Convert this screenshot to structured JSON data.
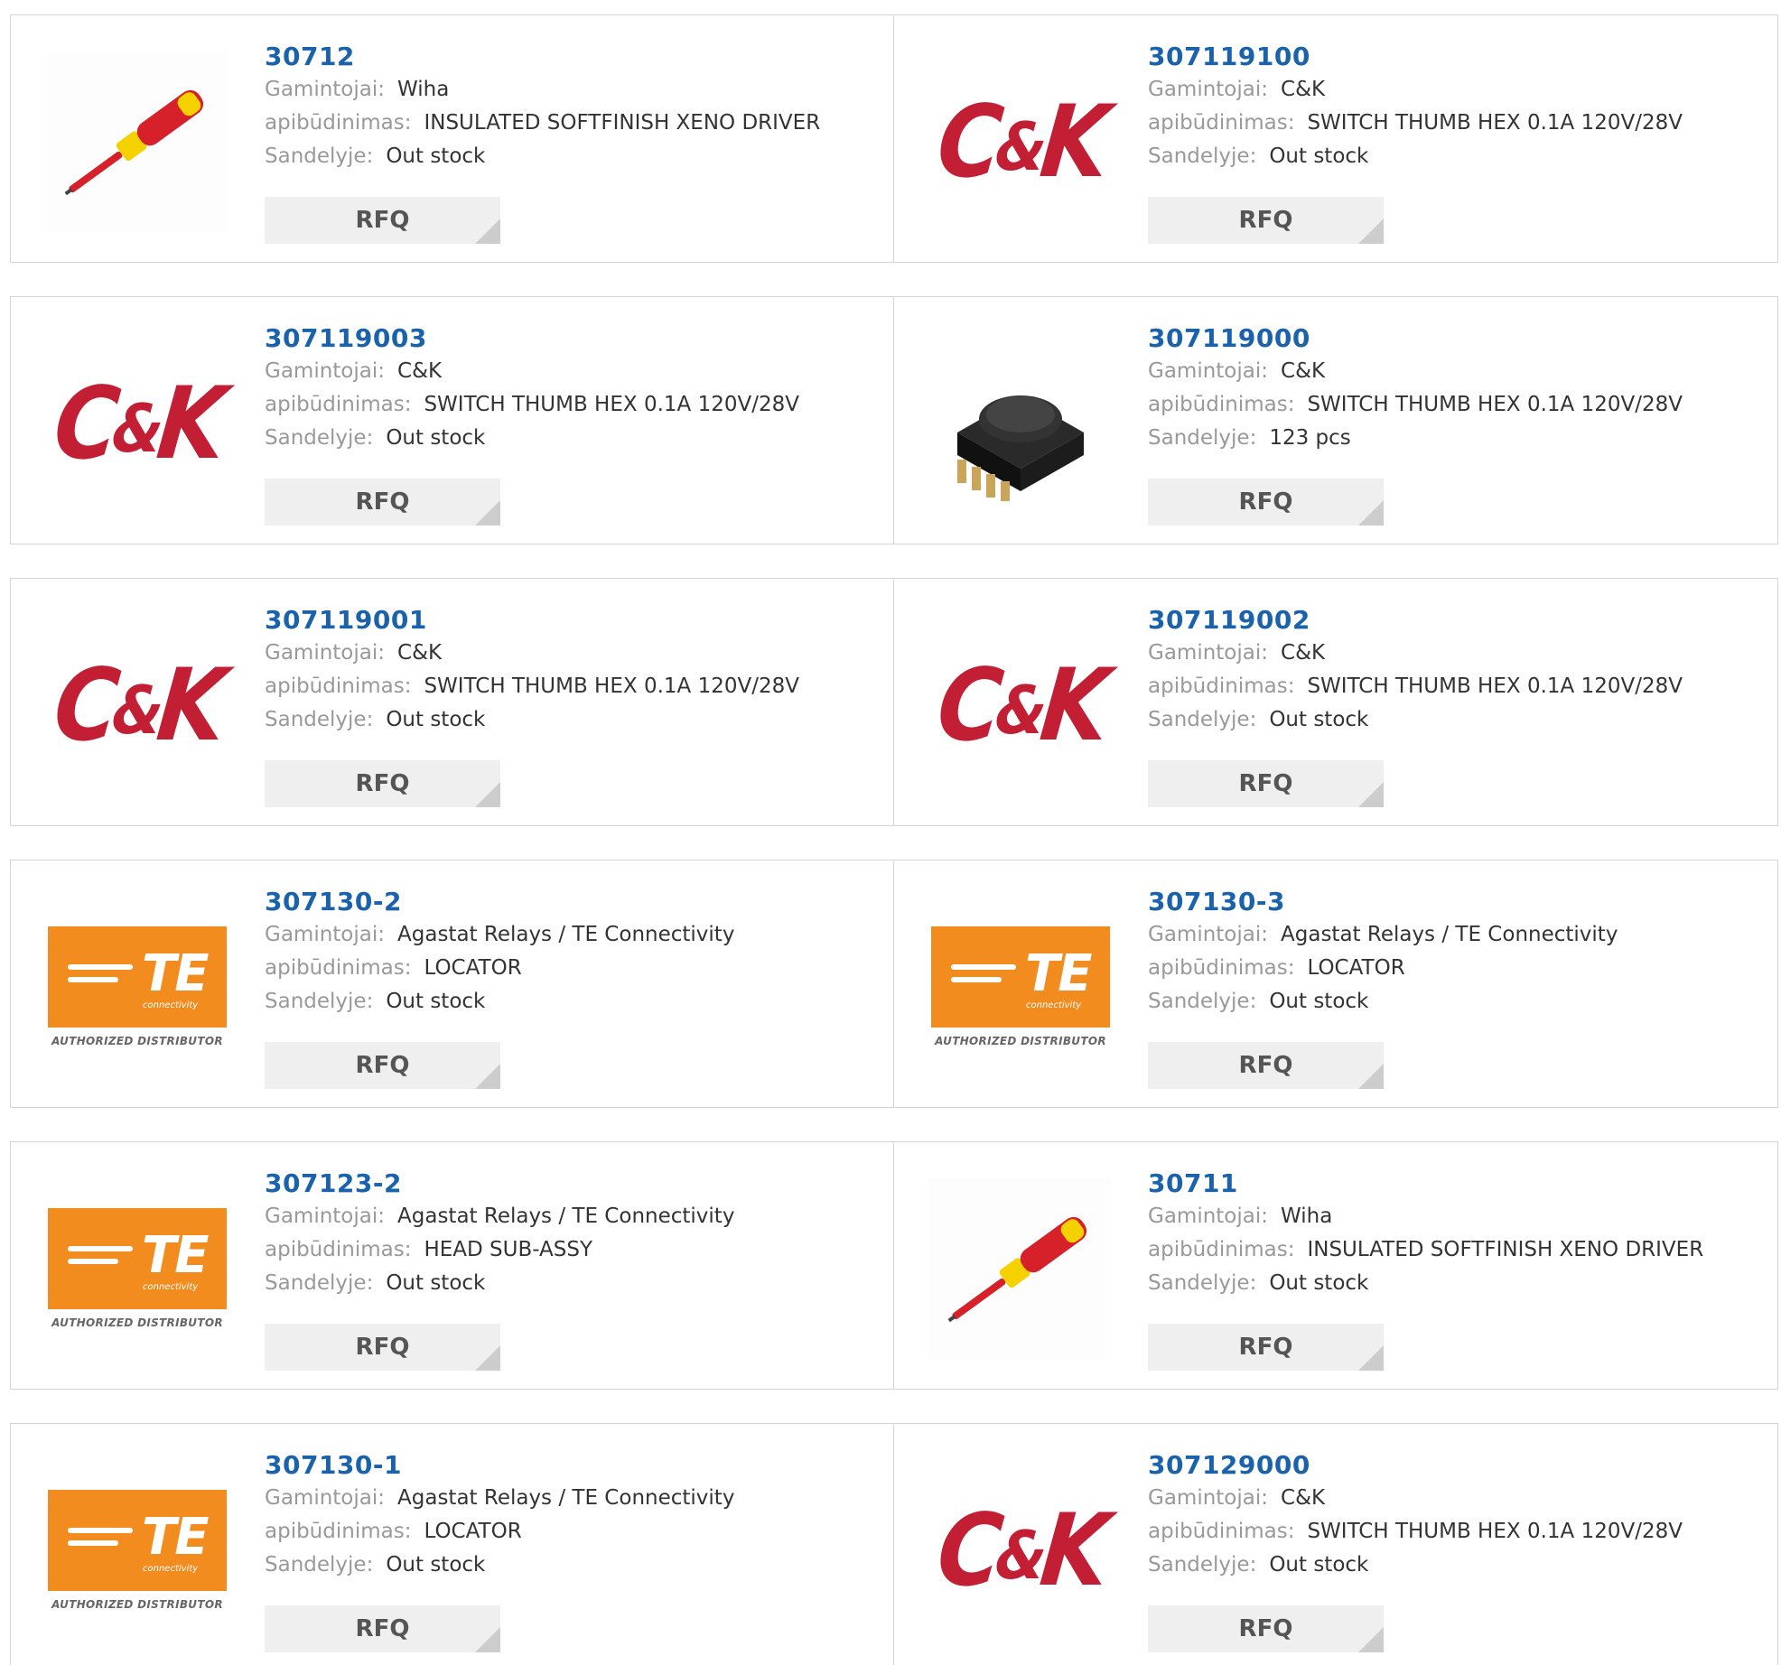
{
  "labels": {
    "manufacturer": "Gamintojai:",
    "description": "apibūdinimas:",
    "stock": "Sandelyje:",
    "rfq": "RFQ"
  },
  "logos": {
    "ck": {
      "c": "C",
      "amp": "&",
      "k": "K"
    },
    "te": {
      "word": "TE",
      "sub": "connectivity",
      "authorized": "AUTHORIZED DISTRIBUTOR"
    }
  },
  "colors": {
    "link": "#1a62ab",
    "ck_red": "#c21f35",
    "te_orange": "#f28c1e"
  },
  "products": [
    {
      "pn": "30712",
      "manufacturer": "Wiha",
      "description": "INSULATED SOFTFINISH XENO DRIVER",
      "stock": "Out stock",
      "image": "screwdriver"
    },
    {
      "pn": "307119100",
      "manufacturer": "C&K",
      "description": "SWITCH THUMB HEX 0.1A 120V/28V",
      "stock": "Out stock",
      "image": "ck-logo"
    },
    {
      "pn": "307119003",
      "manufacturer": "C&K",
      "description": "SWITCH THUMB HEX 0.1A 120V/28V",
      "stock": "Out stock",
      "image": "ck-logo"
    },
    {
      "pn": "307119000",
      "manufacturer": "C&K",
      "description": "SWITCH THUMB HEX 0.1A 120V/28V",
      "stock": "123 pcs",
      "image": "thumbwheel-switch"
    },
    {
      "pn": "307119001",
      "manufacturer": "C&K",
      "description": "SWITCH THUMB HEX 0.1A 120V/28V",
      "stock": "Out stock",
      "image": "ck-logo"
    },
    {
      "pn": "307119002",
      "manufacturer": "C&K",
      "description": "SWITCH THUMB HEX 0.1A 120V/28V",
      "stock": "Out stock",
      "image": "ck-logo"
    },
    {
      "pn": "307130-2",
      "manufacturer": "Agastat Relays / TE Connectivity",
      "description": "LOCATOR",
      "stock": "Out stock",
      "image": "te-logo"
    },
    {
      "pn": "307130-3",
      "manufacturer": "Agastat Relays / TE Connectivity",
      "description": "LOCATOR",
      "stock": "Out stock",
      "image": "te-logo"
    },
    {
      "pn": "307123-2",
      "manufacturer": "Agastat Relays / TE Connectivity",
      "description": "HEAD SUB-ASSY",
      "stock": "Out stock",
      "image": "te-logo"
    },
    {
      "pn": "30711",
      "manufacturer": "Wiha",
      "description": "INSULATED SOFTFINISH XENO DRIVER",
      "stock": "Out stock",
      "image": "screwdriver"
    },
    {
      "pn": "307130-1",
      "manufacturer": "Agastat Relays / TE Connectivity",
      "description": "LOCATOR",
      "stock": "Out stock",
      "image": "te-logo"
    },
    {
      "pn": "307129000",
      "manufacturer": "C&K",
      "description": "SWITCH THUMB HEX 0.1A 120V/28V",
      "stock": "Out stock",
      "image": "ck-logo"
    }
  ]
}
